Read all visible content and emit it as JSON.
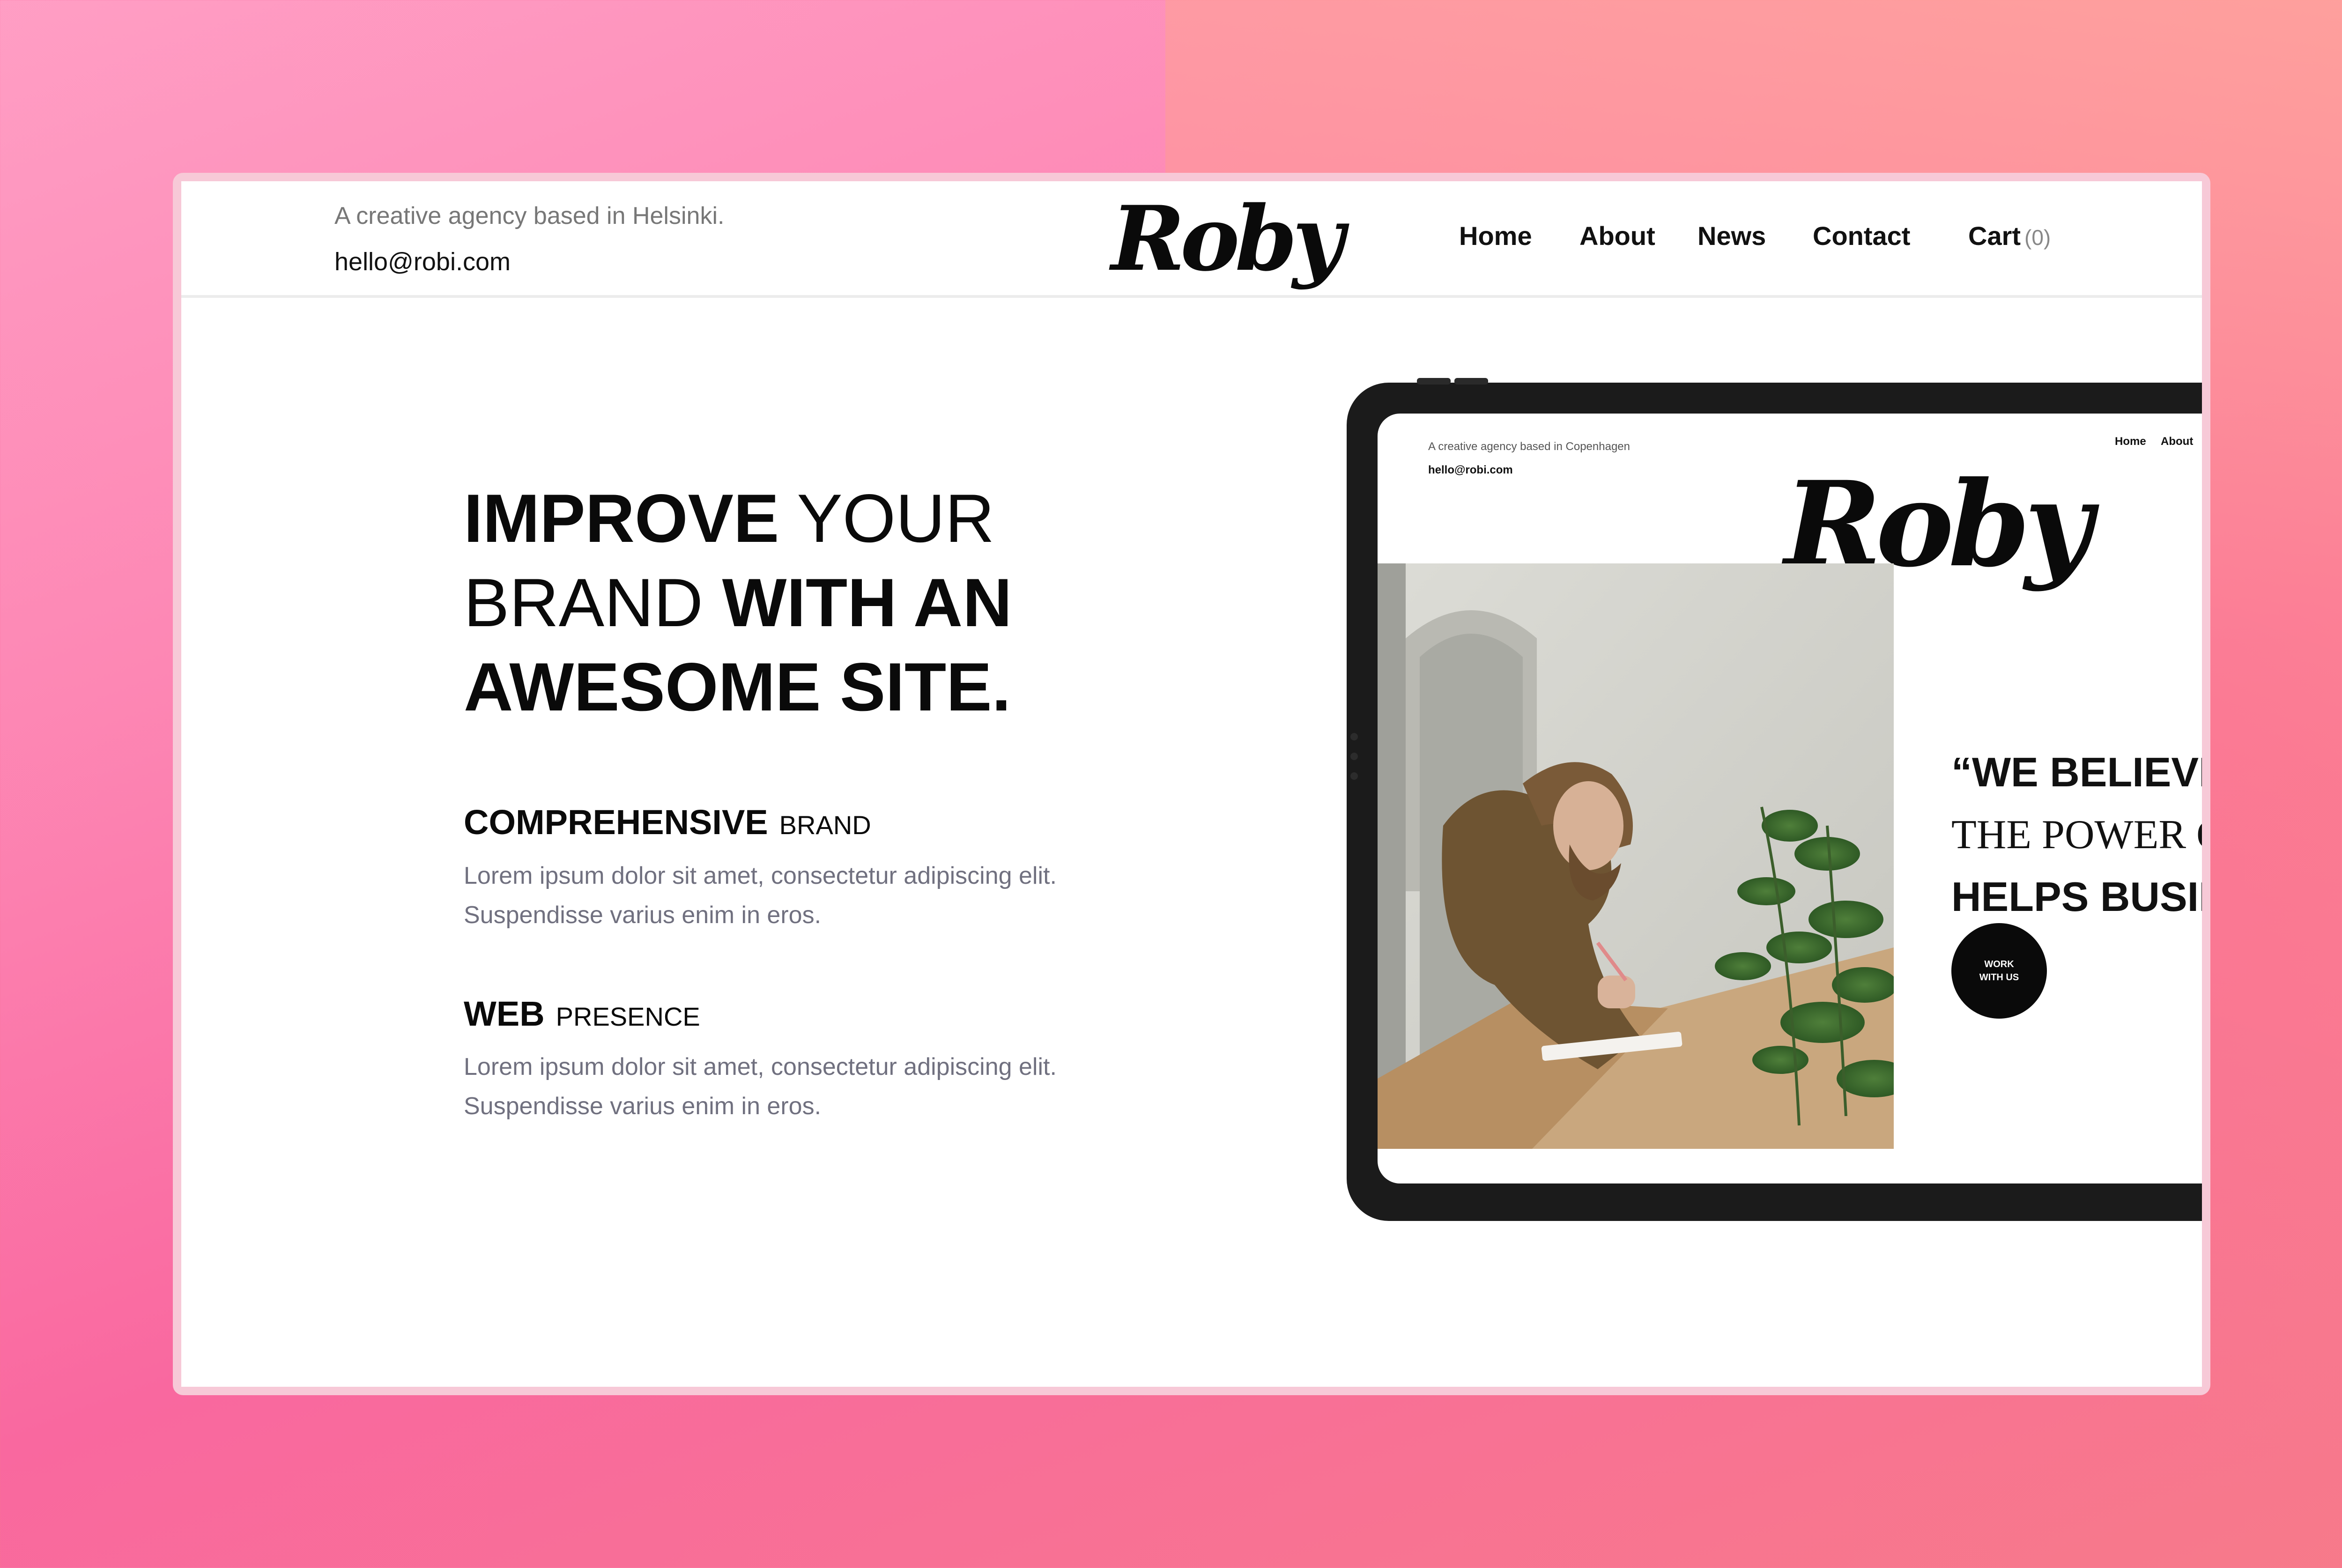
{
  "header": {
    "tagline": "A creative agency based in Helsinki.",
    "email": "hello@robi.com",
    "logo": "Roby",
    "nav": {
      "home": "Home",
      "about": "About",
      "news": "News",
      "contact": "Contact",
      "cart": "Cart",
      "cart_count": "(0)"
    }
  },
  "hero": {
    "headline": {
      "line1_bold": "IMPROVE",
      "line1_light": "YOUR",
      "line2_light": "BRAND",
      "line2_bold": "WITH AN",
      "line3_bold": "AWESOME SITE."
    },
    "features": [
      {
        "title": "COMPREHENSIVE",
        "subtitle": "BRAND",
        "text1": "Lorem ipsum dolor sit amet, consectetur adipiscing elit.",
        "text2": "Suspendisse varius enim in eros."
      },
      {
        "title": "WEB",
        "subtitle": "PRESENCE",
        "text1": "Lorem ipsum dolor sit amet, consectetur adipiscing elit.",
        "text2": "Suspendisse varius enim in eros."
      }
    ]
  },
  "mockup": {
    "tagline": "A creative agency based in Copenhagen",
    "email": "hello@robi.com",
    "nav_home": "Home",
    "nav_about": "About",
    "logo": "Roby",
    "quote_line1": "“WE BELIEVE",
    "quote_line2": "THE POWER OF",
    "quote_line3": "HELPS BUSIN",
    "cta_line1": "WORK",
    "cta_line2": "WITH US"
  },
  "colors": {
    "background_start": "#ff9ec4",
    "background_end": "#f77a8a",
    "text_primary": "#0a0a0a",
    "text_muted": "#70707f"
  }
}
